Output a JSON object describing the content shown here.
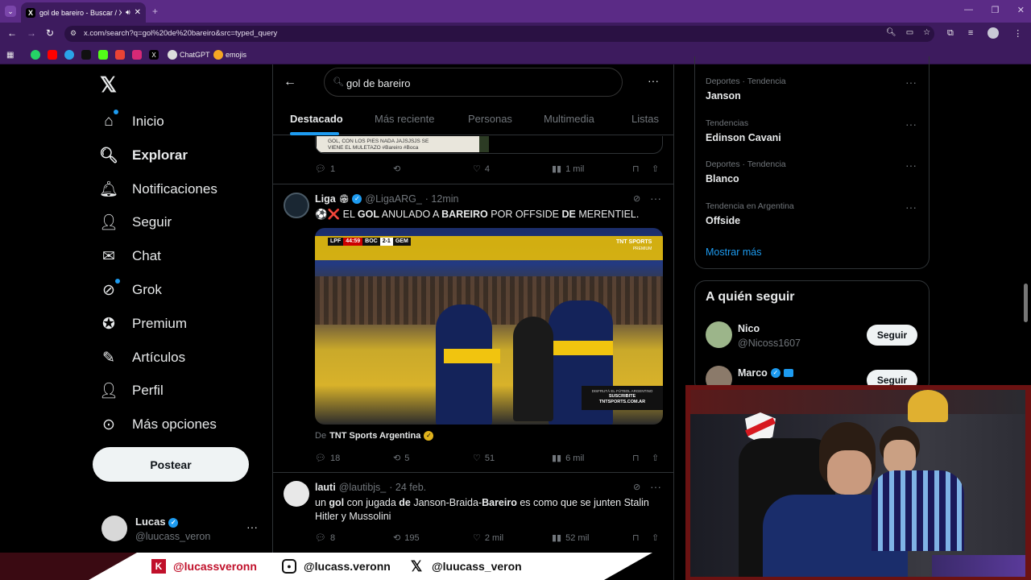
{
  "browser": {
    "tab_title": "gol de bareiro - Buscar / X",
    "url": "x.com/search?q=gol%20de%20bareiro&src=typed_query",
    "bookmarks": [
      {
        "label": "ChatGPT"
      },
      {
        "label": "emojis"
      }
    ]
  },
  "nav": {
    "items": [
      {
        "label": "Inicio",
        "icon": "home-icon"
      },
      {
        "label": "Explorar",
        "icon": "search-icon"
      },
      {
        "label": "Notificaciones",
        "icon": "bell-icon"
      },
      {
        "label": "Seguir",
        "icon": "person-add-icon"
      },
      {
        "label": "Chat",
        "icon": "mail-icon"
      },
      {
        "label": "Grok",
        "icon": "grok-icon"
      },
      {
        "label": "Premium",
        "icon": "verified-badge-icon"
      },
      {
        "label": "Artículos",
        "icon": "document-icon"
      },
      {
        "label": "Perfil",
        "icon": "person-icon"
      },
      {
        "label": "Más opciones",
        "icon": "more-circle-icon"
      }
    ],
    "post_button": "Postear",
    "account": {
      "name": "Lucas",
      "handle": "@luucass_veron"
    }
  },
  "search": {
    "query": "gol de bareiro",
    "tabs": [
      "Destacado",
      "Más reciente",
      "Personas",
      "Multimedia",
      "Listas"
    ],
    "active_tab": "Destacado"
  },
  "prev_tweet": {
    "image_caption_lines": [
      "GOL, CON LOS PIES NADA JAJSJSJS SE",
      "VIENE EL MULETAZO #Bareiro #Boca"
    ],
    "replies": "1",
    "retweets": "",
    "likes": "4",
    "views": "1 mil"
  },
  "tweet1": {
    "name": "Liga",
    "handle": "@LigaARG_",
    "time": "· 12min",
    "text_parts": [
      "⚽❌ EL ",
      "GOL",
      " ANULADO A ",
      "BAREIRO",
      " POR OFFSIDE ",
      "DE",
      " MERENTIEL."
    ],
    "video": {
      "scorebug_league": "LPF",
      "scorebug_time": "44:59",
      "home": "BOC",
      "score": "2-1",
      "away": "GEM",
      "channel": "TNT SPORTS",
      "channel_sub": "PREMIUM",
      "promo_top": "DISFRUTÁ EL FÚTBOL ARGENTINO",
      "promo_1": "SUSCRIBITE",
      "promo_2": "TNTSPORTS.COM.AR"
    },
    "source_prefix": "De",
    "source": "TNT Sports Argentina",
    "replies": "18",
    "retweets": "5",
    "likes": "51",
    "views": "6 mil"
  },
  "tweet2": {
    "name": "lauti",
    "handle": "@lautibjs_",
    "time": "· 24 feb.",
    "text_parts": [
      "un ",
      "gol",
      " con jugada ",
      "de",
      " Janson-Braida-",
      "Bareiro",
      " es como que se junten Stalin Hitler y Mussolini"
    ],
    "replies": "8",
    "retweets": "195",
    "likes": "2 mil",
    "views": "52 mil"
  },
  "trends": [
    {
      "category": "Deportes · Tendencia",
      "name": "Janson"
    },
    {
      "category": "Tendencias",
      "name": "Edinson Cavani"
    },
    {
      "category": "Deportes · Tendencia",
      "name": "Blanco"
    },
    {
      "category": "Tendencia en Argentina",
      "name": "Offside"
    }
  ],
  "show_more": "Mostrar más",
  "who_to_follow": {
    "title": "A quién seguir",
    "users": [
      {
        "name": "Nico",
        "handle": "@Nicoss1607",
        "button": "Seguir"
      },
      {
        "name": "Marco",
        "handle": "",
        "button": "Seguir"
      }
    ]
  },
  "overlay": {
    "socials": [
      {
        "icon": "kick-icon",
        "handle": "@lucassveronn"
      },
      {
        "icon": "instagram-icon",
        "handle": "@lucass.veronn"
      },
      {
        "icon": "x-logo-icon",
        "handle": "@luucass_veron"
      }
    ]
  },
  "colors": {
    "browser_frame": "#5b2b86",
    "x_blue": "#1d9bf0",
    "banner_red": "#c0102a",
    "webcam_frame": "#6b1212"
  }
}
